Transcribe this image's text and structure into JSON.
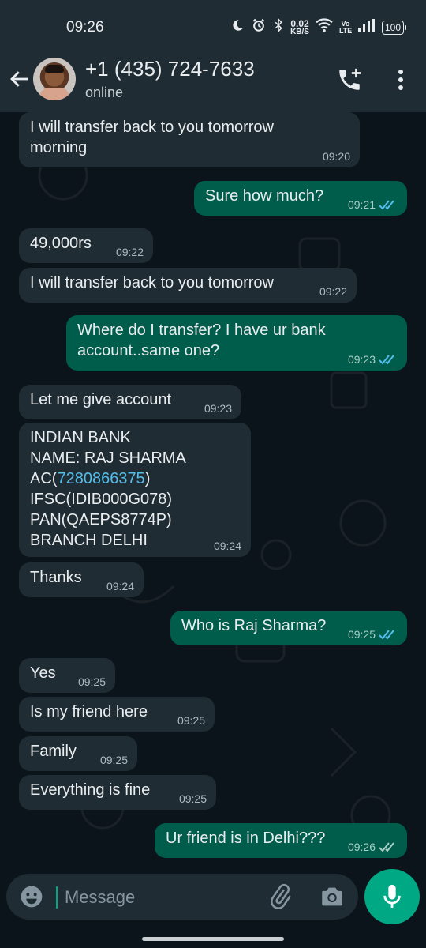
{
  "status_bar": {
    "time": "09:26",
    "net_speed": "0.02",
    "net_unit": "KB/S",
    "volte": "Vo LTE",
    "battery": "100"
  },
  "header": {
    "contact_name": "+1 (435) 724-7633",
    "status": "online",
    "icons": [
      "back-arrow-icon",
      "add-call-icon",
      "more-vert-icon"
    ]
  },
  "messages": [
    {
      "dir": "in",
      "text": "I will transfer back to you tomorrow\nmorning",
      "time": "09:20"
    },
    {
      "dir": "out",
      "text": "Sure how much?",
      "time": "09:21",
      "read": true
    },
    {
      "dir": "in",
      "text": "49,000rs",
      "time": "09:22"
    },
    {
      "dir": "in",
      "text": "I will transfer back to you tomorrow",
      "time": "09:22"
    },
    {
      "dir": "out",
      "text": "Where do I transfer? I have ur bank\naccount..same one?",
      "time": "09:23",
      "read": true
    },
    {
      "dir": "in",
      "text": "Let me give account",
      "time": "09:23"
    },
    {
      "dir": "in",
      "line1": "INDIAN BANK",
      "line2": "NAME: RAJ SHARMA",
      "line3_prefix": "AC(",
      "line3_link": "7280866375",
      "line3_suffix": ")",
      "line4": "IFSC(IDIB000G078)",
      "line5": "PAN(QAEPS8774P)",
      "line6": "BRANCH DELHI",
      "time": "09:24"
    },
    {
      "dir": "in",
      "text": "Thanks",
      "time": "09:24"
    },
    {
      "dir": "out",
      "text": "Who is Raj Sharma?",
      "time": "09:25",
      "read": true
    },
    {
      "dir": "in",
      "text": "Yes",
      "time": "09:25"
    },
    {
      "dir": "in",
      "text": "Is my friend here",
      "time": "09:25"
    },
    {
      "dir": "in",
      "text": "Family",
      "time": "09:25"
    },
    {
      "dir": "in",
      "text": "Everything is fine",
      "time": "09:25"
    },
    {
      "dir": "out",
      "text": "Ur friend is in Delhi???",
      "time": "09:26",
      "read": false
    }
  ],
  "composer": {
    "placeholder": "Message",
    "icons": [
      "emoji-icon",
      "attach-icon",
      "camera-icon",
      "mic-icon"
    ]
  },
  "colors": {
    "background": "#0b141a",
    "header": "#1f2c34",
    "incoming_bubble": "#202c33",
    "outgoing_bubble": "#005c4b",
    "accent": "#00a884",
    "link": "#53bdeb",
    "read_ticks": "#53bdeb"
  }
}
